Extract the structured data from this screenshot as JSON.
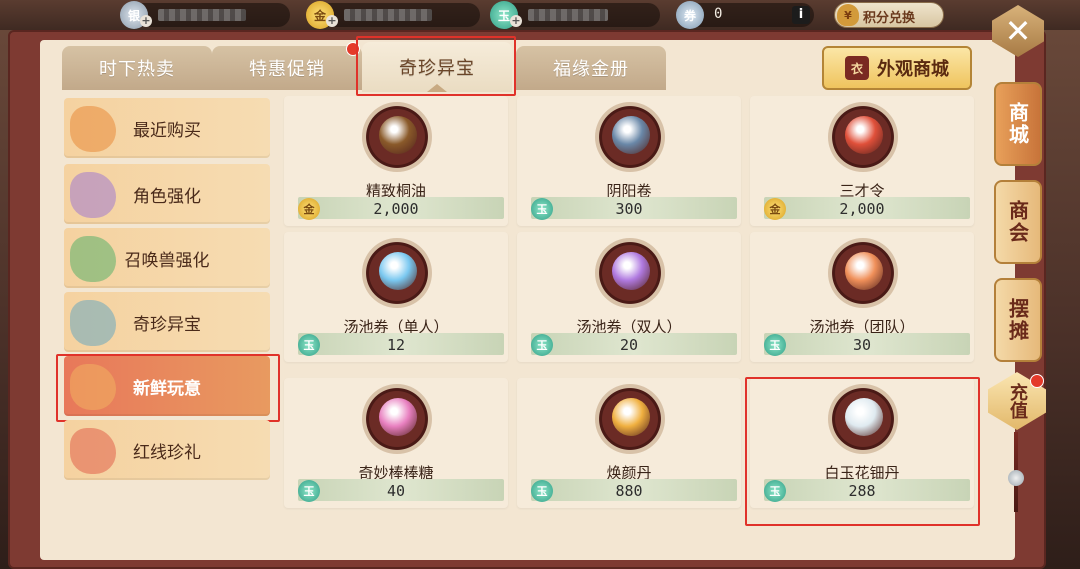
{
  "currency": [
    {
      "id": "silver",
      "value_hidden": true
    },
    {
      "id": "gold",
      "value_hidden": true
    },
    {
      "id": "jade",
      "value_hidden": true
    },
    {
      "id": "ticket",
      "value": "0"
    }
  ],
  "exchange_label": "积分兑换",
  "tabs": [
    "时下热卖",
    "特惠促销",
    "奇珍异宝",
    "福缘金册"
  ],
  "active_tab": "奇珍异宝",
  "outfit_button": "外观商城",
  "categories": [
    "最近购买",
    "角色强化",
    "召唤兽强化",
    "奇珍异宝",
    "新鲜玩意",
    "红线珍礼"
  ],
  "active_category": "新鲜玩意",
  "items": [
    {
      "name": "精致桐油",
      "price": "2,000",
      "currency": "gold",
      "icon": "bucket-icon",
      "color": "#8a5a2a"
    },
    {
      "name": "阴阳卷",
      "price": "300",
      "currency": "jade",
      "icon": "scroll-icon",
      "color": "#6a88a8"
    },
    {
      "name": "三才令",
      "price": "2,000",
      "currency": "gold",
      "icon": "talisman-icon",
      "color": "#e0503a"
    },
    {
      "name": "汤池券（单人）",
      "price": "12",
      "currency": "jade",
      "icon": "ticket-blue-icon",
      "color": "#7ac8f0"
    },
    {
      "name": "汤池券（双人）",
      "price": "20",
      "currency": "jade",
      "icon": "ticket-purple-icon",
      "color": "#b07ae0"
    },
    {
      "name": "汤池券（团队）",
      "price": "30",
      "currency": "jade",
      "icon": "ticket-orange-icon",
      "color": "#f0905a"
    },
    {
      "name": "奇妙棒棒糖",
      "price": "40",
      "currency": "jade",
      "icon": "lollipop-icon",
      "color": "#e880c0"
    },
    {
      "name": "焕颜丹",
      "price": "880",
      "currency": "jade",
      "icon": "golden-pill-icon",
      "color": "#f0b040"
    },
    {
      "name": "白玉花钿丹",
      "price": "288",
      "currency": "jade",
      "icon": "white-pill-icon",
      "color": "#dfeaf0"
    }
  ],
  "side_tabs": [
    "商城",
    "商会",
    "摆摊"
  ],
  "recharge_label": "充值",
  "colors": {
    "panel_frame": "#7e3a32",
    "panel_bg": "#f3e6d2",
    "highlight": "#e0322a",
    "gold": "#d8a020",
    "jade": "#2f9e86"
  }
}
